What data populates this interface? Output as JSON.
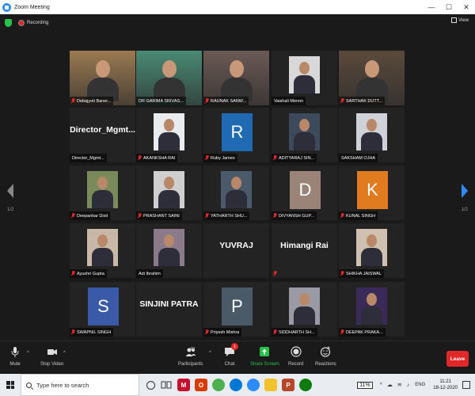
{
  "window": {
    "title": "Zoom Meeting",
    "controls": [
      "—",
      "☐",
      "✕"
    ]
  },
  "meeting": {
    "recording_label": "Recording",
    "view_label": "View",
    "page_left": "1/2",
    "page_right": "1/2"
  },
  "tiles": [
    {
      "name": "Debajyoti Baner...",
      "kind": "video",
      "bg": "#9c7a52",
      "muted": true
    },
    {
      "name": "DR GARIMA SRIVAS...",
      "kind": "video",
      "bg": "#4a8a74",
      "muted": false,
      "active": true
    },
    {
      "name": "RAUNAK SANW...",
      "kind": "video",
      "bg": "#6b5a55",
      "muted": true
    },
    {
      "name": "Vaishali Menon",
      "kind": "photo",
      "bg": "#d8d8d8",
      "muted": false
    },
    {
      "name": "SARTHAK DUTT...",
      "kind": "video",
      "bg": "#5a4a3c",
      "muted": true
    },
    {
      "name": "Director_Mgmt...",
      "kind": "text",
      "big": "Director_Mgmt...",
      "muted": false
    },
    {
      "name": "AKANKSHA RAI",
      "kind": "photo",
      "bg": "#e8ecef",
      "muted": true
    },
    {
      "name": "Ruby James",
      "kind": "letter",
      "letter": "R",
      "bg": "#1f6ab3",
      "muted": true
    },
    {
      "name": "ADITYARAJ SIN...",
      "kind": "photo",
      "bg": "#3c4a5c",
      "muted": true
    },
    {
      "name": "SAKSHAM OJHA",
      "kind": "photo",
      "bg": "#cfd3d8",
      "muted": false
    },
    {
      "name": "Deepankar Dixit",
      "kind": "photo",
      "bg": "#7a8a5a",
      "muted": true
    },
    {
      "name": "PRASHANT SAINI",
      "kind": "photo",
      "bg": "#cfcfcf",
      "muted": true
    },
    {
      "name": "YATHARTH SHU...",
      "kind": "photo",
      "bg": "#4b5a6a",
      "muted": true
    },
    {
      "name": "DIVYANSH GUP...",
      "kind": "letter",
      "letter": "D",
      "bg": "#9a8478",
      "muted": true
    },
    {
      "name": "KUNAL SINGH",
      "kind": "letter",
      "letter": "K",
      "bg": "#e07b1f",
      "muted": true
    },
    {
      "name": "Ayushri Gupta",
      "kind": "photo",
      "bg": "#c9b8a8",
      "muted": true
    },
    {
      "name": "Adi Ibrahim",
      "kind": "photo",
      "bg": "#8a7a8a",
      "muted": false
    },
    {
      "name": "YUVRAJ",
      "kind": "text",
      "big": "YUVRAJ",
      "muted": false,
      "noplate": true
    },
    {
      "name": "Himangi Rai",
      "kind": "text",
      "big": "Himangi Rai",
      "muted": true,
      "noplate": true
    },
    {
      "name": "SHIKHA JAISWAL",
      "kind": "photo",
      "bg": "#d0c0b0",
      "muted": true
    },
    {
      "name": "SWAPNIL SINGH",
      "kind": "letter",
      "letter": "S",
      "bg": "#3a5aa8",
      "muted": true
    },
    {
      "name": "SINJINI PATRA",
      "kind": "text",
      "big": "SINJINI PATRA",
      "muted": false,
      "noplate": true
    },
    {
      "name": "Priyesh Mishra",
      "kind": "letter",
      "letter": "P",
      "bg": "#4a5a66",
      "muted": true
    },
    {
      "name": "SIDDHARTH SH...",
      "kind": "photo",
      "bg": "#9a9aa5",
      "muted": true
    },
    {
      "name": "DEEPAK PRAKA...",
      "kind": "photo",
      "bg": "#3a2a5a",
      "muted": true
    }
  ],
  "toolbar": {
    "mute": "Mute",
    "stop_video": "Stop Video",
    "participants": "Participants",
    "participants_count": "49",
    "chat": "Chat",
    "chat_badge": "1",
    "share_screen": "Share Screen",
    "record": "Record",
    "reactions": "Reactions",
    "leave": "Leave"
  },
  "taskbar": {
    "search_placeholder": "Type here to search",
    "battery": "11%",
    "lang": "ENG",
    "time": "11:21",
    "date": "18-12-2020"
  },
  "colors": {
    "accent": "#2d8cff",
    "share_green": "#27c24c",
    "leave_red": "#e02828",
    "active_border": "#e3e35a"
  }
}
